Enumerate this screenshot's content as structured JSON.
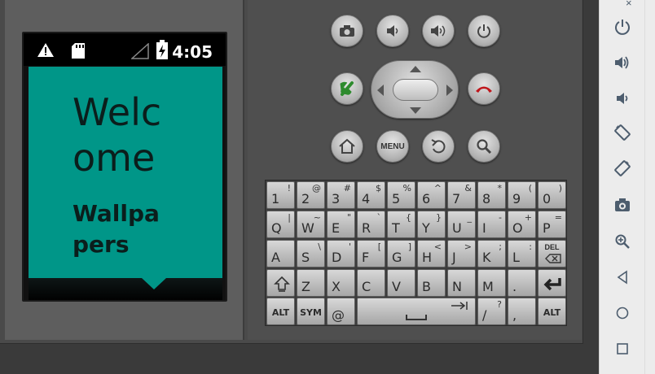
{
  "device": {
    "status_bar": {
      "time": "4:05",
      "icons": [
        "warning-icon",
        "sd-card-icon",
        "no-signal-icon",
        "battery-charging-icon"
      ]
    },
    "app": {
      "title": "Welcome",
      "subtitle": "Wallpapers"
    }
  },
  "hardware_buttons": {
    "row1": [
      "camera",
      "volume-down",
      "volume-up",
      "power"
    ],
    "call_colors": {
      "call": "#2e8b2e",
      "end_call": "#c0161b"
    },
    "menu_label": "MENU"
  },
  "keyboard": {
    "rows": [
      [
        {
          "main": "1",
          "alt": "!"
        },
        {
          "main": "2",
          "alt": "@"
        },
        {
          "main": "3",
          "alt": "#"
        },
        {
          "main": "4",
          "alt": "$"
        },
        {
          "main": "5",
          "alt": "%"
        },
        {
          "main": "6",
          "alt": "^"
        },
        {
          "main": "7",
          "alt": "&"
        },
        {
          "main": "8",
          "alt": "*"
        },
        {
          "main": "9",
          "alt": "("
        },
        {
          "main": "0",
          "alt": ")"
        }
      ],
      [
        {
          "main": "Q",
          "alt": "|"
        },
        {
          "main": "W",
          "alt": "~"
        },
        {
          "main": "E",
          "alt": "\""
        },
        {
          "main": "R",
          "alt": "`"
        },
        {
          "main": "T",
          "alt": "{"
        },
        {
          "main": "Y",
          "alt": "}"
        },
        {
          "main": "U",
          "alt": "_"
        },
        {
          "main": "I",
          "alt": "-"
        },
        {
          "main": "O",
          "alt": "+"
        },
        {
          "main": "P",
          "alt": "="
        }
      ],
      [
        {
          "main": "A",
          "alt": ""
        },
        {
          "main": "S",
          "alt": "\\"
        },
        {
          "main": "D",
          "alt": "'"
        },
        {
          "main": "F",
          "alt": "["
        },
        {
          "main": "G",
          "alt": "]"
        },
        {
          "main": "H",
          "alt": "<"
        },
        {
          "main": "J",
          "alt": ">"
        },
        {
          "main": "K",
          "alt": ";"
        },
        {
          "main": "L",
          "alt": ":"
        },
        {
          "main": "DEL",
          "alt": ""
        }
      ],
      [
        {
          "main": "shift",
          "alt": ""
        },
        {
          "main": "Z",
          "alt": ""
        },
        {
          "main": "X",
          "alt": ""
        },
        {
          "main": "C",
          "alt": ""
        },
        {
          "main": "V",
          "alt": ""
        },
        {
          "main": "B",
          "alt": ""
        },
        {
          "main": "N",
          "alt": ""
        },
        {
          "main": "M",
          "alt": ""
        },
        {
          "main": ".",
          "alt": ""
        },
        {
          "main": "enter",
          "alt": ""
        }
      ]
    ],
    "bottom_row": {
      "alt_left": "ALT",
      "sym": "SYM",
      "at": "@",
      "slash": "/",
      "slash_alt": "?",
      "comma": ",",
      "alt_right": "ALT"
    }
  },
  "toolbar": {
    "items": [
      "power-icon",
      "volume-up-icon",
      "volume-down-icon",
      "rotate-left-icon",
      "rotate-right-icon",
      "camera-icon",
      "zoom-icon",
      "back-icon",
      "home-icon",
      "overview-icon"
    ],
    "icon_color": "#4d5d6e"
  }
}
